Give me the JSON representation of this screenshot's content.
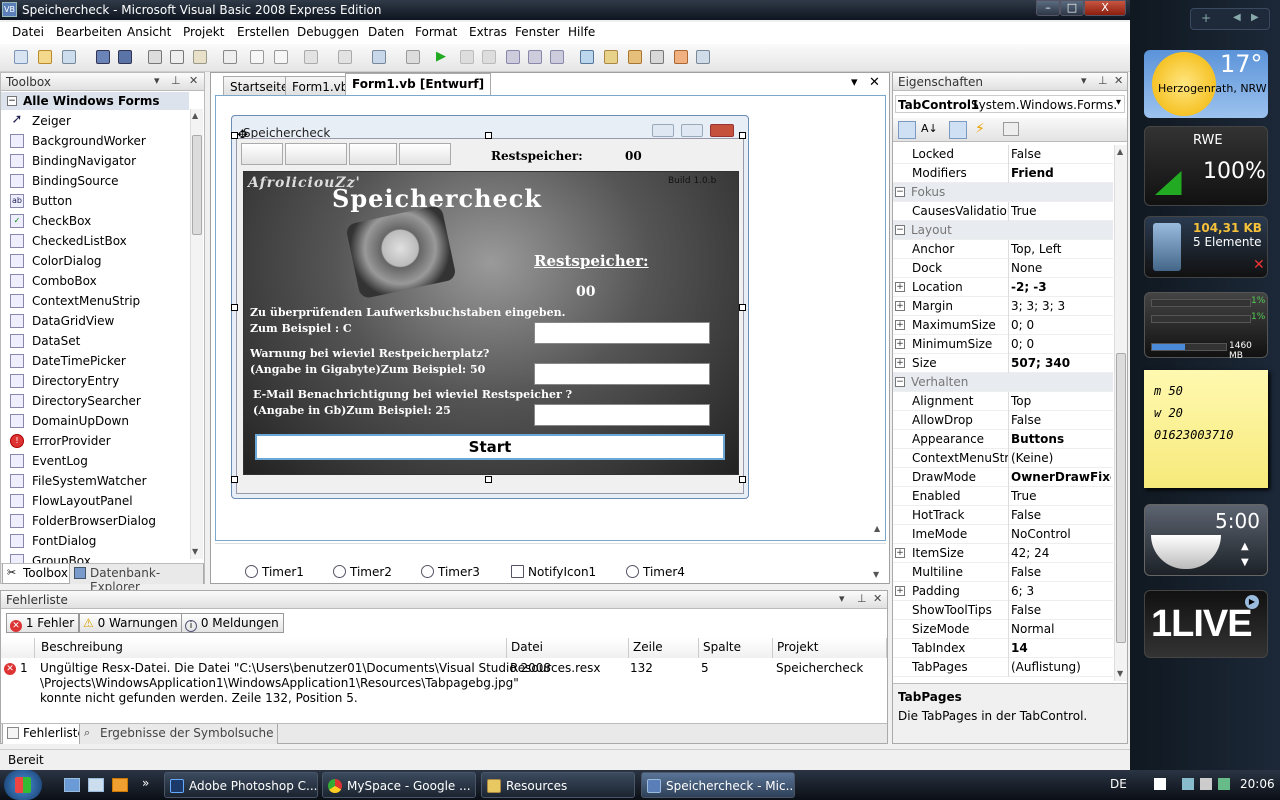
{
  "window": {
    "title": "Speichercheck - Microsoft Visual Basic 2008 Express Edition",
    "icon": "VB",
    "min": "–",
    "max": "□",
    "close": "X"
  },
  "menu": [
    "Datei",
    "Bearbeiten",
    "Ansicht",
    "Projekt",
    "Erstellen",
    "Debuggen",
    "Daten",
    "Format",
    "Extras",
    "Fenster",
    "Hilfe"
  ],
  "toolbox": {
    "title": "Toolbox",
    "group": "Alle Windows Forms",
    "items": [
      "Zeiger",
      "BackgroundWorker",
      "BindingNavigator",
      "BindingSource",
      "Button",
      "CheckBox",
      "CheckedListBox",
      "ColorDialog",
      "ComboBox",
      "ContextMenuStrip",
      "DataGridView",
      "DataSet",
      "DateTimePicker",
      "DirectoryEntry",
      "DirectorySearcher",
      "DomainUpDown",
      "ErrorProvider",
      "EventLog",
      "FileSystemWatcher",
      "FlowLayoutPanel",
      "FolderBrowserDialog",
      "FontDialog",
      "GroupBox"
    ],
    "tab_toolbox": "Toolbox",
    "tab_db": "Datenbank-Explorer"
  },
  "doc": {
    "tabs": [
      "Startseite",
      "Form1.vb",
      "Form1.vb [Entwurf]"
    ],
    "close": "✕",
    "dropdown": "▾"
  },
  "form": {
    "title": "Speichercheck",
    "restspeicher_label": "Restspeicher:",
    "restspeicher_value": "00",
    "logo_text": "AfroliciouZz'",
    "heading": "Speichercheck",
    "build": "Build 1.0.b",
    "big_label": "Restspeicher:",
    "big_value": "00",
    "q1a": "Zu überprüfenden Laufwerksbuchstaben eingeben.",
    "q1b": "Zum Beispiel : C",
    "q2a": "Warnung bei wieviel Restpeicherplatz?",
    "q2b": "(Angabe in Gigabyte)Zum Beispiel: 50",
    "q3a": "E-Mail Benachrichtigung bei wieviel Restspeicher ?",
    "q3b": "(Angabe in Gb)Zum Beispiel: 25",
    "start": "Start"
  },
  "tray": [
    "Timer1",
    "Timer2",
    "Timer3",
    "NotifyIcon1",
    "Timer4"
  ],
  "props": {
    "title": "Eigenschaften",
    "object": "TabControl1",
    "object_type": "System.Windows.Forms.Ta",
    "rows": [
      {
        "n": "Locked",
        "v": "False"
      },
      {
        "n": "Modifiers",
        "v": "Friend",
        "b": true
      },
      {
        "cat": "Fokus"
      },
      {
        "n": "CausesValidation",
        "v": "True"
      },
      {
        "cat": "Layout"
      },
      {
        "n": "Anchor",
        "v": "Top, Left"
      },
      {
        "n": "Dock",
        "v": "None"
      },
      {
        "n": "Location",
        "v": "-2; -3",
        "b": true,
        "ex": true
      },
      {
        "n": "Margin",
        "v": "3; 3; 3; 3",
        "ex": true
      },
      {
        "n": "MaximumSize",
        "v": "0; 0",
        "ex": true
      },
      {
        "n": "MinimumSize",
        "v": "0; 0",
        "ex": true
      },
      {
        "n": "Size",
        "v": "507; 340",
        "b": true,
        "ex": true
      },
      {
        "cat": "Verhalten"
      },
      {
        "n": "Alignment",
        "v": "Top"
      },
      {
        "n": "AllowDrop",
        "v": "False"
      },
      {
        "n": "Appearance",
        "v": "Buttons",
        "b": true
      },
      {
        "n": "ContextMenuStrip",
        "v": "(Keine)"
      },
      {
        "n": "DrawMode",
        "v": "OwnerDrawFixed",
        "b": true
      },
      {
        "n": "Enabled",
        "v": "True"
      },
      {
        "n": "HotTrack",
        "v": "False"
      },
      {
        "n": "ImeMode",
        "v": "NoControl"
      },
      {
        "n": "ItemSize",
        "v": "42; 24",
        "ex": true
      },
      {
        "n": "Multiline",
        "v": "False"
      },
      {
        "n": "Padding",
        "v": "6; 3",
        "ex": true
      },
      {
        "n": "ShowToolTips",
        "v": "False"
      },
      {
        "n": "SizeMode",
        "v": "Normal"
      },
      {
        "n": "TabIndex",
        "v": "14",
        "b": true
      },
      {
        "n": "TabPages",
        "v": "(Auflistung)"
      }
    ],
    "desc_title": "TabPages",
    "desc_text": "Die TabPages in der TabControl."
  },
  "errors": {
    "title": "Fehlerliste",
    "btn_errors": "1 Fehler",
    "btn_warnings": "0 Warnungen",
    "btn_messages": "0 Meldungen",
    "cols": [
      "Beschreibung",
      "Datei",
      "Zeile",
      "Spalte",
      "Projekt"
    ],
    "row": {
      "num": "1",
      "desc1": "Ungültige Resx-Datei. Die Datei \"C:\\Users\\benutzer01\\Documents\\Visual Studio 2008",
      "desc2": "\\Projects\\WindowsApplication1\\WindowsApplication1\\Resources\\Tabpagebg.jpg\"",
      "desc3": "konnte nicht gefunden werden. Zeile 132, Position 5.",
      "file": "Resources.resx",
      "line": "132",
      "col": "5",
      "project": "Speichercheck"
    },
    "tab_errors": "Fehlerliste",
    "tab_search": "Ergebnisse der Symbolsuche"
  },
  "status": "Bereit",
  "taskbar": {
    "tasks": [
      "Adobe Photoshop C...",
      "MySpace - Google ...",
      "Resources",
      "Speichercheck - Mic..."
    ],
    "lang": "DE",
    "clock": "20:06"
  },
  "gadgets": {
    "temp": "17°",
    "city": "Herzogenrath, NRW",
    "rss": "RWE",
    "pct": "100%",
    "recycle_size": "104,31 KB",
    "recycle_items": "5 Elemente",
    "cpu1": "1%",
    "cpu2": "1%",
    "mem": "1460 MB",
    "note1": "m 50",
    "note2": "w 20",
    "note3": "01623003710",
    "time": "5:00",
    "radio": "1LIVE"
  }
}
